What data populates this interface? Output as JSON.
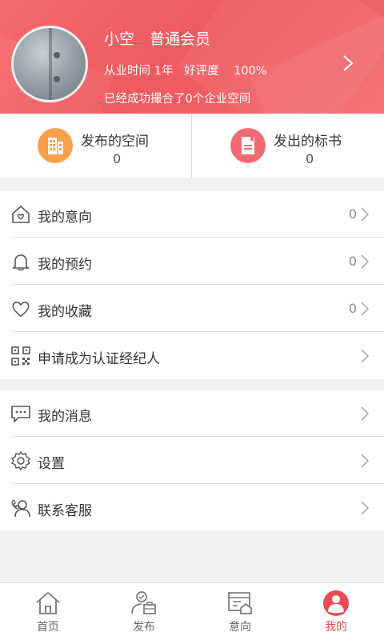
{
  "profile": {
    "name": "小空",
    "member_level": "普通会员",
    "stats_line": "从业时间 1年   好评度    100%",
    "matched_note": "已经成功撮合了0个企业空间"
  },
  "summary": [
    {
      "title": "发布的空间",
      "count": "0",
      "icon": "building-icon",
      "color": "#f8a04b"
    },
    {
      "title": "发出的标书",
      "count": "0",
      "icon": "document-icon",
      "color": "#f06a72"
    }
  ],
  "menu_group_1": [
    {
      "label": "我的意向",
      "count": "0",
      "icon": "home-heart-icon"
    },
    {
      "label": "我的预约",
      "count": "0",
      "icon": "bell-icon"
    },
    {
      "label": "我的收藏",
      "count": "0",
      "icon": "heart-icon"
    },
    {
      "label": "申请成为认证经纪人",
      "count": "",
      "icon": "qr-code-icon"
    }
  ],
  "menu_group_2": [
    {
      "label": "我的消息",
      "icon": "message-icon"
    },
    {
      "label": "设置",
      "icon": "gear-icon"
    },
    {
      "label": "联系客服",
      "icon": "customer-service-icon"
    }
  ],
  "tabs": [
    {
      "label": "首页",
      "icon": "home-icon",
      "active": false
    },
    {
      "label": "发布",
      "icon": "publish-icon",
      "active": false
    },
    {
      "label": "意向",
      "icon": "intention-icon",
      "active": false
    },
    {
      "label": "我的",
      "icon": "profile-icon",
      "active": true
    }
  ],
  "colors": {
    "header": "#f0595d",
    "accent": "#e94b50",
    "orange": "#f8a04b",
    "pink": "#f06a72"
  }
}
